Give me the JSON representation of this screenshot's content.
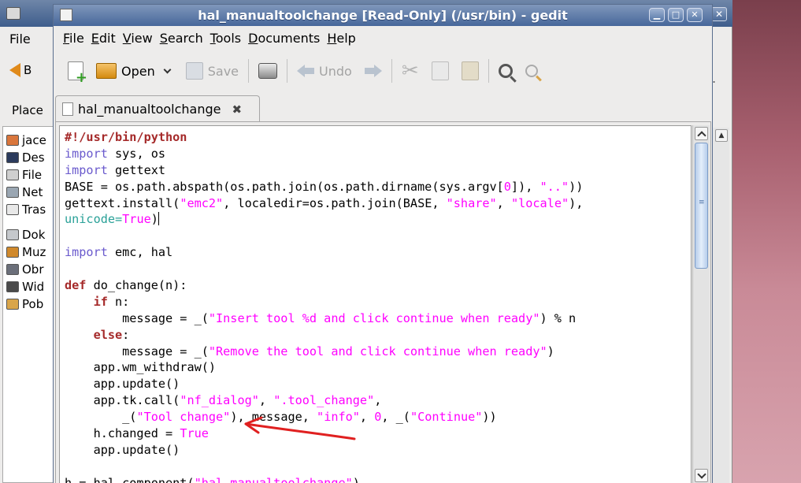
{
  "background_window": {
    "menu_file": "File",
    "back_label": "B",
    "places_label": "Place",
    "sidebar_items": [
      "jace",
      "Des",
      "File",
      "Net",
      "Tras",
      "Dok",
      "Muz",
      "Obr",
      "Wid",
      "Pob"
    ],
    "more_dot": "."
  },
  "window": {
    "title": "hal_manualtoolchange [Read-Only] (/usr/bin) - gedit"
  },
  "menubar": [
    {
      "key": "F",
      "rest": "ile"
    },
    {
      "key": "E",
      "rest": "dit"
    },
    {
      "key": "V",
      "rest": "iew"
    },
    {
      "key": "S",
      "rest": "earch"
    },
    {
      "key": "T",
      "rest": "ools"
    },
    {
      "key": "D",
      "rest": "ocuments"
    },
    {
      "key": "H",
      "rest": "elp"
    }
  ],
  "toolbar": {
    "open_label": "Open",
    "save_label": "Save",
    "undo_label": "Undo"
  },
  "tab": {
    "title": "hal_manualtoolchange",
    "close_glyph": "✖"
  },
  "colors": {
    "keyword": "#a52a2a",
    "string": "#ff00ff",
    "annotation": "#e02020"
  },
  "code_lines": [
    [
      [
        "kw",
        "#!/usr/bin/python"
      ]
    ],
    [
      [
        "kw2",
        "import"
      ],
      [
        "",
        "sys, os"
      ]
    ],
    [
      [
        "kw2",
        "import"
      ],
      [
        "",
        "gettext"
      ]
    ],
    [
      [
        "",
        "BASE = os.path.abspath(os.path.join(os.path.dirname(sys.argv["
      ],
      [
        "cnst",
        "0"
      ],
      [
        "",
        "]), "
      ],
      [
        "str",
        "\"..\""
      ],
      [
        "",
        "))"
      ]
    ],
    [
      [
        "",
        "gettext.install("
      ],
      [
        "str",
        "\"emc2\""
      ],
      [
        "",
        ", localedir=os.path.join(BASE, "
      ],
      [
        "str",
        "\"share\""
      ],
      [
        "",
        ", "
      ],
      [
        "str",
        "\"locale\""
      ],
      [
        "",
        "),"
      ]
    ],
    [
      [
        "bool",
        "unicode="
      ],
      [
        "bool2",
        "True"
      ],
      [
        "",
        ")"
      ],
      [
        "cursor",
        ""
      ]
    ],
    [],
    [
      [
        "kw2",
        "import"
      ],
      [
        "",
        "emc, hal"
      ]
    ],
    [],
    [
      [
        "kw",
        "def"
      ],
      [
        "",
        "do_change(n):"
      ]
    ],
    [
      [
        "",
        "    "
      ],
      [
        "kw",
        "if"
      ],
      [
        "",
        "n:"
      ]
    ],
    [
      [
        "",
        "        message = _("
      ],
      [
        "str",
        "\"Insert tool %d and click continue when ready\""
      ],
      [
        "",
        ") % n"
      ]
    ],
    [
      [
        "",
        "    "
      ],
      [
        "kw",
        "else"
      ],
      [
        "",
        ":"
      ]
    ],
    [
      [
        "",
        "        message = _("
      ],
      [
        "str",
        "\"Remove the tool and click continue when ready\""
      ],
      [
        "",
        ")"
      ]
    ],
    [
      [
        "",
        "    app.wm_withdraw()"
      ]
    ],
    [
      [
        "",
        "    app.update()"
      ]
    ],
    [
      [
        "",
        "    app.tk.call("
      ],
      [
        "str",
        "\"nf_dialog\""
      ],
      [
        "",
        ", "
      ],
      [
        "str",
        "\".tool_change\""
      ],
      [
        "",
        ","
      ]
    ],
    [
      [
        "",
        "        _("
      ],
      [
        "str",
        "\"Tool change\""
      ],
      [
        "",
        "), message, "
      ],
      [
        "str",
        "\"info\""
      ],
      [
        "",
        ", "
      ],
      [
        "cnst",
        "0"
      ],
      [
        "",
        ", _("
      ],
      [
        "str",
        "\"Continue\""
      ],
      [
        "",
        "))"
      ]
    ],
    [
      [
        "",
        "    h.changed = "
      ],
      [
        "bool2",
        "True"
      ]
    ],
    [
      [
        "",
        "    app.update()"
      ]
    ],
    [],
    [
      [
        "",
        "h = hal.component("
      ],
      [
        "str",
        "\"hal_manualtoolchange\""
      ],
      [
        "",
        ")"
      ]
    ]
  ]
}
